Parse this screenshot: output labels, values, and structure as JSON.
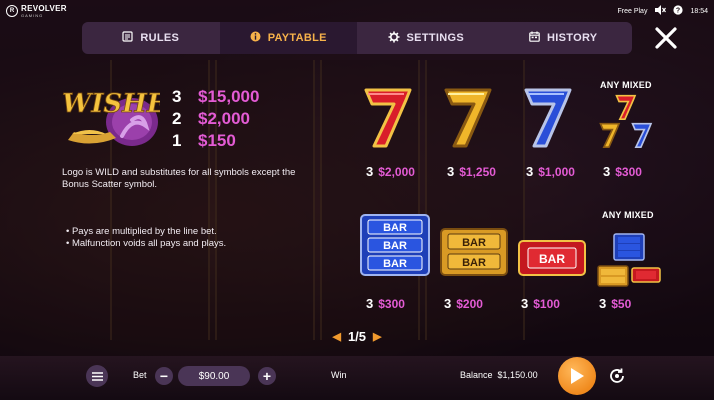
{
  "topbar": {
    "brand": "REVOLVER",
    "brand_sub": "GAMING",
    "mode": "Free Play",
    "time": "18:54"
  },
  "tabs": [
    {
      "label": "RULES",
      "icon": "book-icon"
    },
    {
      "label": "PAYTABLE",
      "icon": "info-icon",
      "active": true
    },
    {
      "label": "SETTINGS",
      "icon": "gear-icon"
    },
    {
      "label": "HISTORY",
      "icon": "calendar-icon"
    }
  ],
  "logo_symbol": {
    "name": "WISHES",
    "pays": [
      {
        "count": "3",
        "amount": "$15,000"
      },
      {
        "count": "2",
        "amount": "$2,000"
      },
      {
        "count": "1",
        "amount": "$150"
      }
    ],
    "description": "Logo is WILD and substitutes for all symbols except the Bonus Scatter symbol."
  },
  "rules": [
    "Pays are multiplied by the line bet.",
    "Malfunction voids all pays and plays."
  ],
  "sevens": [
    {
      "symbol": "red-seven",
      "count": "3",
      "amount": "$2,000"
    },
    {
      "symbol": "gold-seven",
      "count": "3",
      "amount": "$1,250"
    },
    {
      "symbol": "blue-seven",
      "count": "3",
      "amount": "$1,000"
    },
    {
      "symbol": "mixed-sevens",
      "count": "3",
      "amount": "$300",
      "label": "ANY MIXED"
    }
  ],
  "bars": [
    {
      "symbol": "blue-triple-bar",
      "count": "3",
      "amount": "$300"
    },
    {
      "symbol": "gold-double-bar",
      "count": "3",
      "amount": "$200"
    },
    {
      "symbol": "red-single-bar",
      "count": "3",
      "amount": "$100"
    },
    {
      "symbol": "mixed-bars",
      "count": "3",
      "amount": "$50",
      "label": "ANY MIXED"
    }
  ],
  "bar_text": "BAR",
  "pager": {
    "text": "1/5"
  },
  "bottom": {
    "bet_label": "Bet",
    "bet_value": "$90.00",
    "win_label": "Win",
    "balance_label": "Balance",
    "balance_value": "$1,150.00"
  },
  "colors": {
    "accent": "#e35bd4",
    "tab_active": "#f7b24a",
    "spin": "#f08a1e"
  }
}
